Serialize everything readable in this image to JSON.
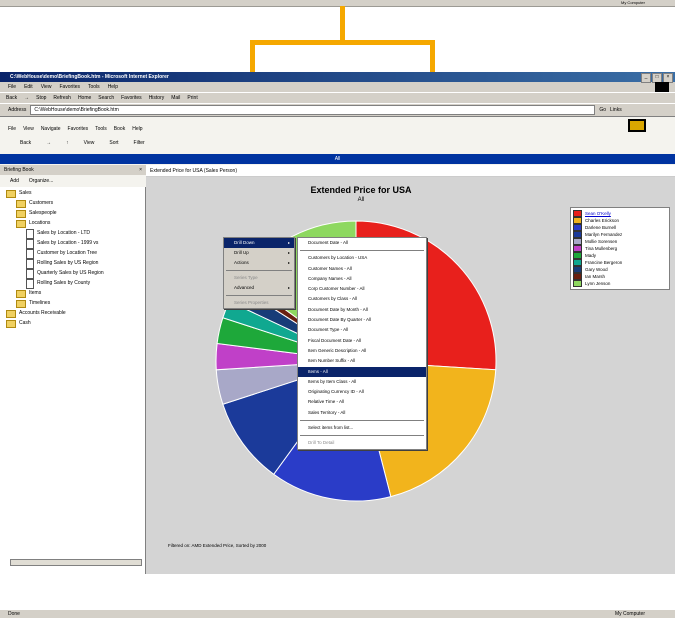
{
  "top_strip": {
    "left": "",
    "right": "My Computer"
  },
  "window": {
    "title": "C:\\WebHouse\\demo\\BriefingBook.htm - Microsoft Internet Explorer",
    "buttons": [
      "_",
      "□",
      "×"
    ],
    "menu": [
      "File",
      "Edit",
      "View",
      "Favorites",
      "Tools",
      "Help"
    ],
    "toolbar": [
      "Back",
      "→",
      "Stop",
      "Refresh",
      "Home",
      "Search",
      "Favorites",
      "History",
      "Mail",
      "Print"
    ],
    "address_label": "Address",
    "address_value": "C:\\WebHouse\\demo\\BriefingBook.htm",
    "go_label": "Go",
    "links_label": "Links"
  },
  "app": {
    "menu": [
      "File",
      "View",
      "Navigate",
      "Favorites",
      "Tools",
      "Book",
      "Help"
    ],
    "toolbar": [
      "Back",
      "View",
      "Sort",
      "Filter"
    ],
    "breadcrumb": "All"
  },
  "left_pane": {
    "title": "Briefing Book",
    "close": "×",
    "actions": [
      "Add",
      "Organize..."
    ],
    "tree": [
      {
        "label": "Sales",
        "type": "folder",
        "level": 0
      },
      {
        "label": "Customers",
        "type": "folder",
        "level": 1
      },
      {
        "label": "Salespeople",
        "type": "folder",
        "level": 1
      },
      {
        "label": "Locations",
        "type": "folder",
        "level": 1
      },
      {
        "label": "Sales by Location - LTD",
        "type": "doc",
        "level": 2
      },
      {
        "label": "Sales by Location - 1999 vs",
        "type": "doc",
        "level": 2
      },
      {
        "label": "Customer by Location Tree",
        "type": "doc",
        "level": 2
      },
      {
        "label": "Rolling Sales by US Region",
        "type": "doc",
        "level": 2
      },
      {
        "label": "Quarterly Sales by US Region",
        "type": "doc",
        "level": 2
      },
      {
        "label": "Rolling Sales by County",
        "type": "doc",
        "level": 2
      },
      {
        "label": "Items",
        "type": "folder",
        "level": 1
      },
      {
        "label": "Timelines",
        "type": "folder",
        "level": 1
      },
      {
        "label": "Accounts Receivable",
        "type": "folder",
        "level": 0
      },
      {
        "label": "Cash",
        "type": "folder",
        "level": 0
      }
    ]
  },
  "right_pane": {
    "header": "Extended Price for USA (Sales Person)"
  },
  "chart_data": {
    "type": "pie",
    "title": "Extended Price for USA",
    "subtitle": "All",
    "categories": [
      "Sean O'Kelly",
      "Charles Erickson",
      "Darlene Burnell",
      "Marilyn Fernandez",
      "Mollie Sorensen",
      "Tina Mullenberg",
      "Mady",
      "Francine Bergeron",
      "Gary Wood",
      "Ian Marsh",
      "Lynn Jenson"
    ],
    "values": [
      26,
      20,
      14,
      10,
      4,
      3,
      3,
      2,
      2,
      1,
      15
    ],
    "colors": [
      "#e8201c",
      "#f2b41c",
      "#2a3cc8",
      "#1b3a9a",
      "#a8a8c8",
      "#c040c8",
      "#1ea83a",
      "#10a890",
      "#183c78",
      "#6a2010",
      "#8ed860"
    ],
    "legend_position": "right",
    "footnote": "Filtered on: AMD Extended Price, Sorted by 2000"
  },
  "context_menu": {
    "items": [
      {
        "label": "Drill Down",
        "arrow": "▸",
        "state": "selected"
      },
      {
        "label": "Drill Up",
        "arrow": "▸",
        "state": "normal"
      },
      {
        "label": "Actions",
        "arrow": "▸",
        "state": "normal"
      },
      {
        "label": "---"
      },
      {
        "label": "Series Type",
        "arrow": "",
        "state": "disabled"
      },
      {
        "label": "Advanced",
        "arrow": "▸",
        "state": "normal"
      },
      {
        "label": "---"
      },
      {
        "label": "Series Properties",
        "arrow": "",
        "state": "disabled"
      }
    ]
  },
  "submenu": {
    "items": [
      {
        "label": "Document Date - All",
        "state": "normal"
      },
      {
        "label": "---"
      },
      {
        "label": "Customers by Location - USA",
        "state": "normal"
      },
      {
        "label": "Customer Names - All",
        "state": "normal"
      },
      {
        "label": "Company Names - All",
        "state": "normal"
      },
      {
        "label": "Corp Customer Number - All",
        "state": "normal"
      },
      {
        "label": "Customers by Class - All",
        "state": "normal"
      },
      {
        "label": "Document Date by Month - All",
        "state": "normal"
      },
      {
        "label": "Document Date By Quarter - All",
        "state": "normal"
      },
      {
        "label": "Document Type - All",
        "state": "normal"
      },
      {
        "label": "Fiscal Document Date - All",
        "state": "normal"
      },
      {
        "label": "Item Generic Description - All",
        "state": "normal"
      },
      {
        "label": "Item Number Suffix - All",
        "state": "normal"
      },
      {
        "label": "Items - All",
        "state": "selected"
      },
      {
        "label": "Items by Item Class - All",
        "state": "normal"
      },
      {
        "label": "Originating Currency ID - All",
        "state": "normal"
      },
      {
        "label": "Relative Time - All",
        "state": "normal"
      },
      {
        "label": "Sales Territory - All",
        "state": "normal"
      },
      {
        "label": "---"
      },
      {
        "label": "Select items from list...",
        "state": "normal"
      },
      {
        "label": "---"
      },
      {
        "label": "Drill To Detail",
        "state": "disabled"
      }
    ]
  },
  "status": {
    "left": "Done",
    "right": "My Computer"
  }
}
